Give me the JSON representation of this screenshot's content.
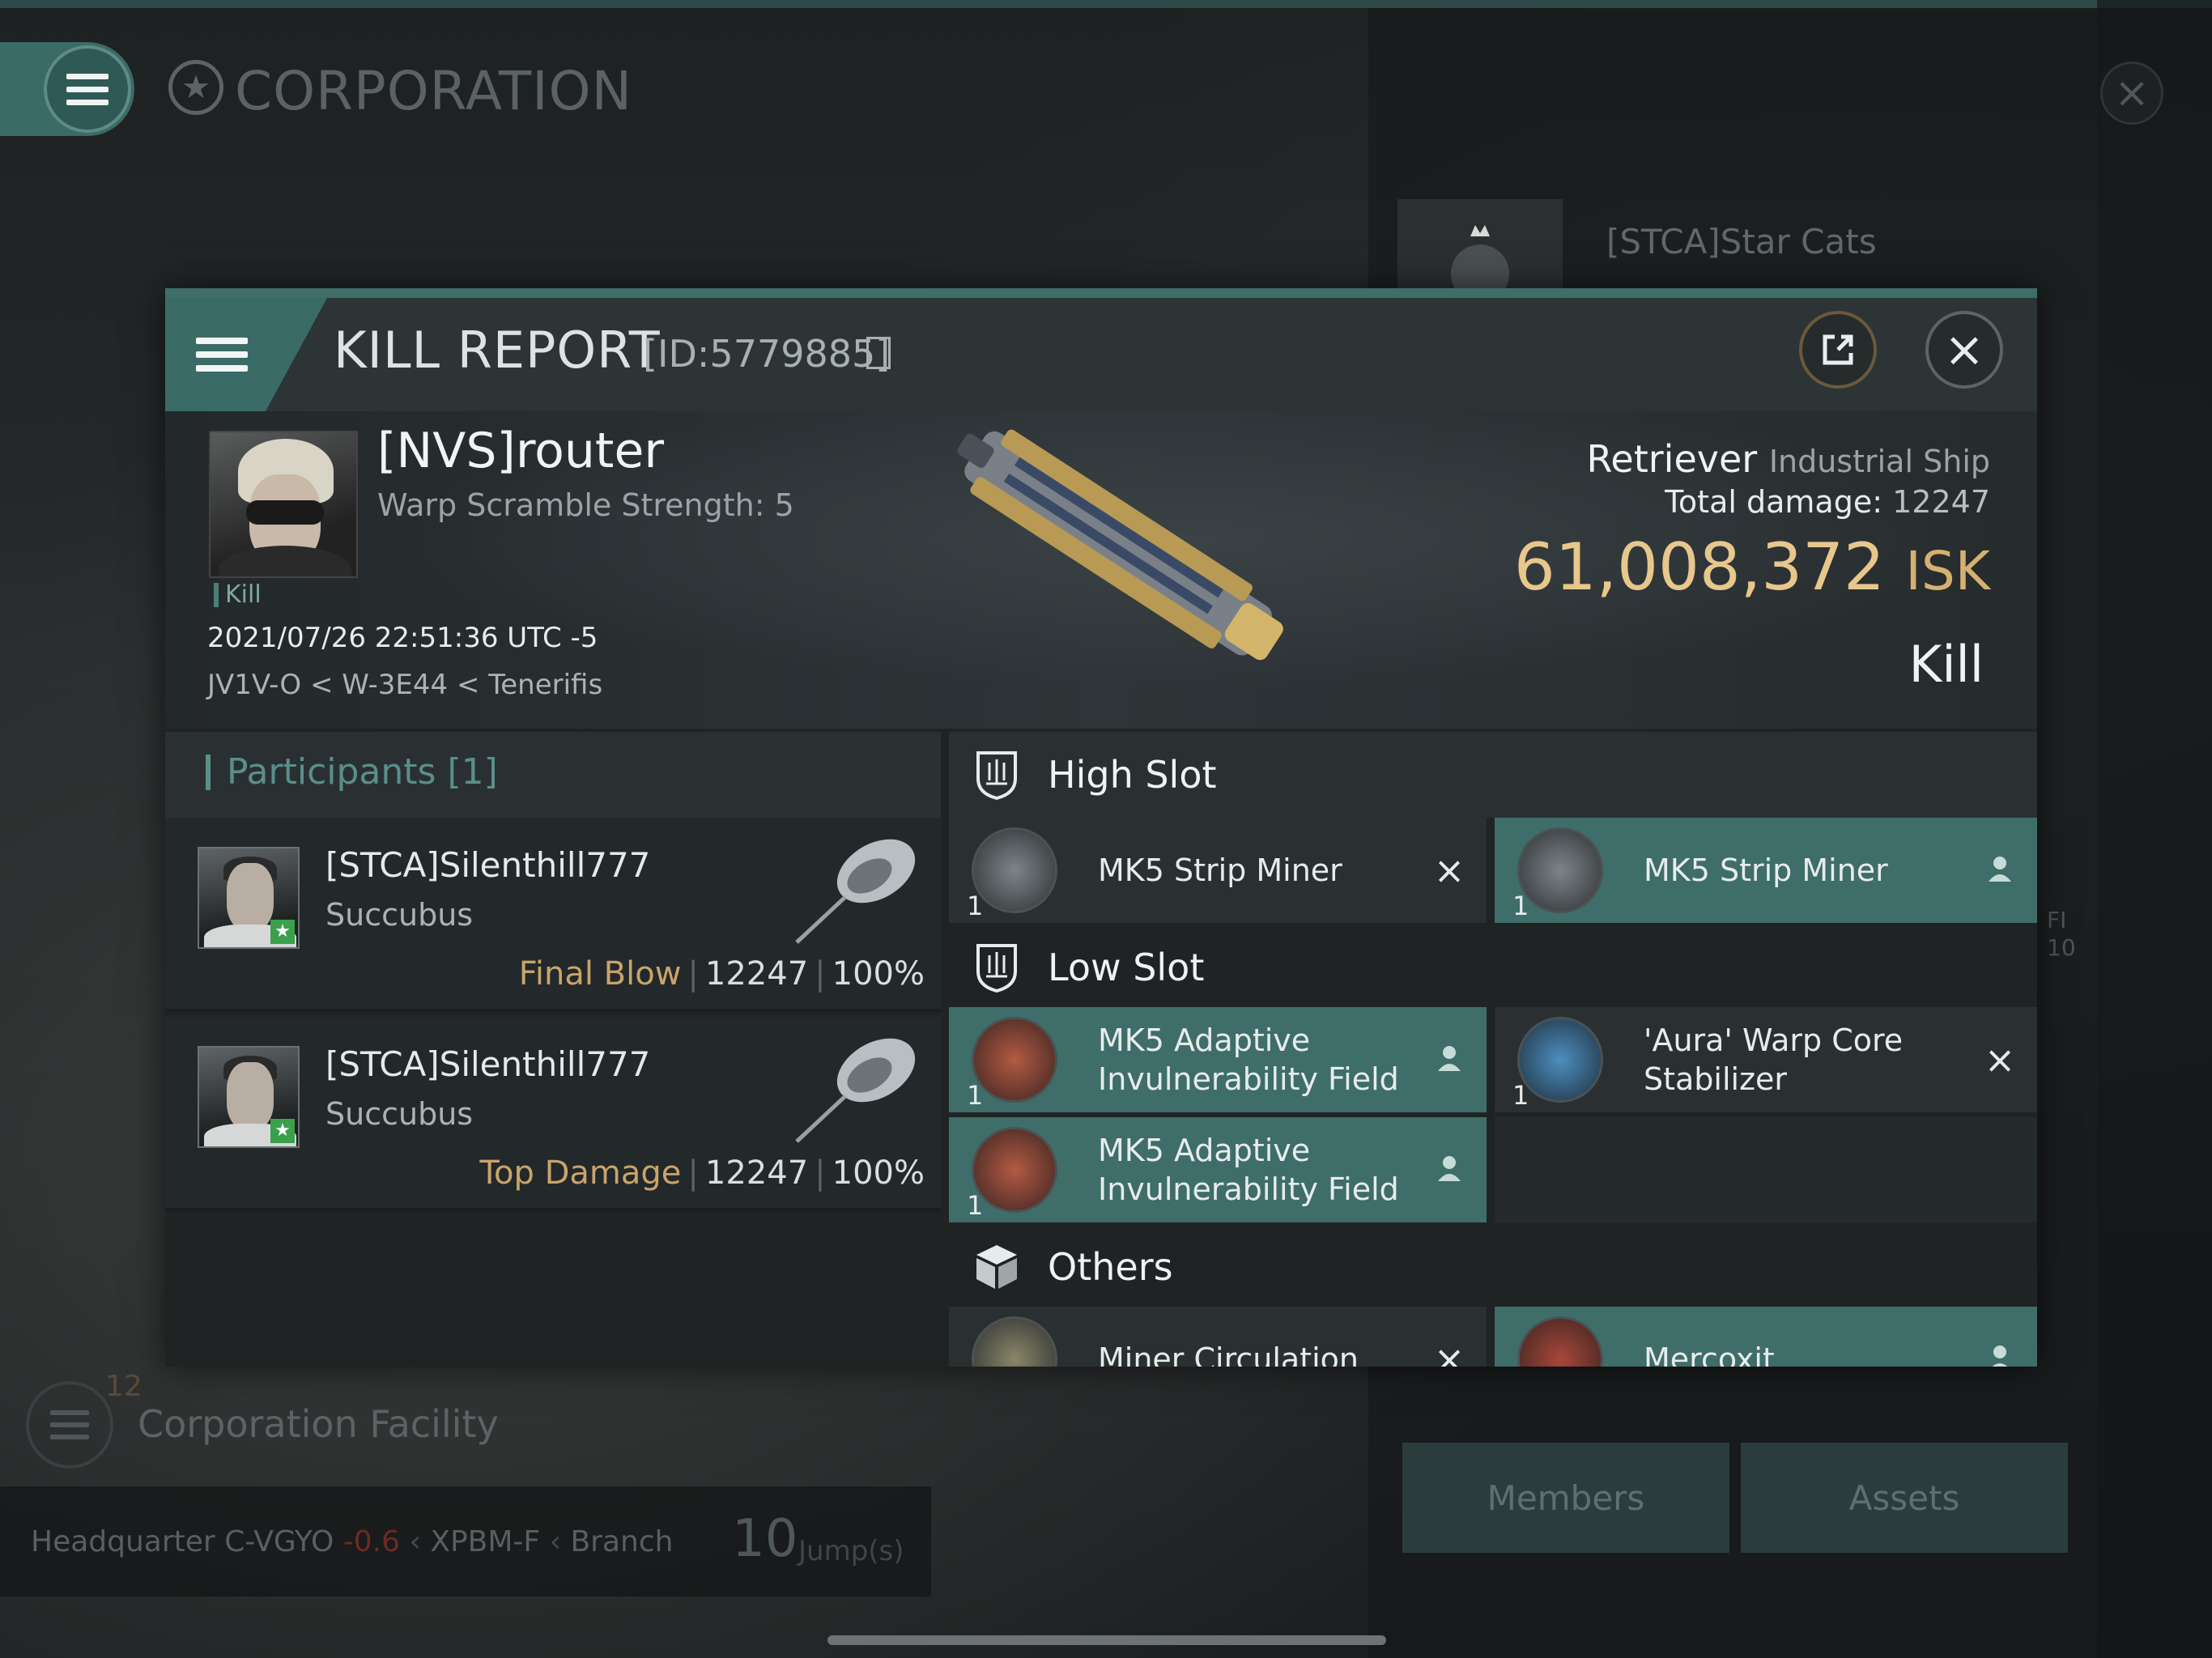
{
  "background": {
    "page_title": "CORPORATION",
    "corp_name": "[STCA]Star Cats",
    "side_text": "FI\n10",
    "facility_count": "12",
    "facility_title": "Corporation Facility",
    "hq_label": "Headquarter",
    "hq_system": "C-VGYO",
    "hq_security": "-0.6",
    "hq_region": "XPBM-F",
    "hq_branch": "Branch",
    "jumps_value": "10",
    "jumps_unit": "Jump(s)",
    "members_label": "Members",
    "assets_label": "Assets"
  },
  "kill_report": {
    "title": "KILL REPORT",
    "id_label": "[ID:5779885]",
    "victim": {
      "name": "[NVS]router",
      "warp_scramble": "Warp Scramble Strength: 5",
      "tag": "Kill",
      "timestamp": "2021/07/26 22:51:36 UTC -5",
      "location": "JV1V-O < W-3E44 < Tenerifis",
      "ship_name": "Retriever",
      "ship_class": "Industrial Ship",
      "total_damage_label": "Total damage:",
      "total_damage_value": "12247",
      "isk_value": "61,008,372",
      "isk_unit": "ISK",
      "result": "Kill"
    },
    "participants": {
      "header": "Participants [1]",
      "rows": [
        {
          "name": "[STCA]Silenthill777",
          "ship": "Succubus",
          "role": "Final Blow",
          "damage": "12247",
          "percent": "100%"
        },
        {
          "name": "[STCA]Silenthill777",
          "ship": "Succubus",
          "role": "Top Damage",
          "damage": "12247",
          "percent": "100%"
        }
      ]
    },
    "fitting": {
      "high_slot_label": "High Slot",
      "high_slots": [
        {
          "qty": "1",
          "name": "MK5 Strip Miner",
          "status": "destroyed"
        },
        {
          "qty": "1",
          "name": "MK5 Strip Miner",
          "status": "dropped"
        }
      ],
      "low_slot_label": "Low Slot",
      "low_slots": [
        {
          "qty": "1",
          "name": "MK5 Adaptive Invulnerability Field",
          "status": "dropped"
        },
        {
          "qty": "1",
          "name": "'Aura' Warp Core Stabilizer",
          "status": "destroyed"
        },
        {
          "qty": "1",
          "name": "MK5 Adaptive Invulnerability Field",
          "status": "dropped"
        }
      ],
      "others_label": "Others",
      "others": [
        {
          "name": "Miner Circulation",
          "status": "destroyed"
        },
        {
          "name": "Mercoxit",
          "status": "dropped"
        }
      ]
    },
    "colors": {
      "accent_teal": "#3f6d69",
      "isk_gold": "#e7c78b",
      "final_blow_gold": "#c9a46a"
    }
  }
}
